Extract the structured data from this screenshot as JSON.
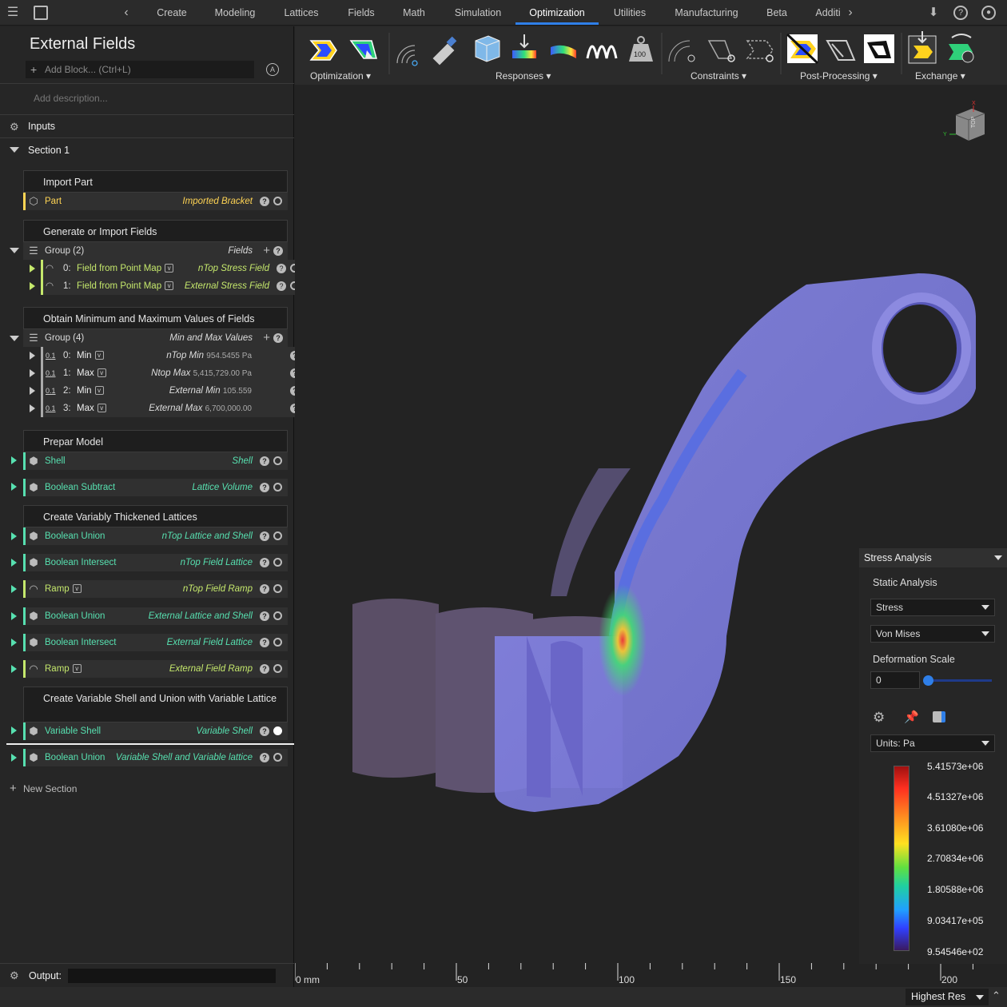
{
  "top_tabs": [
    "Create",
    "Modeling",
    "Lattices",
    "Fields",
    "Math",
    "Simulation",
    "Optimization",
    "Utilities",
    "Manufacturing",
    "Beta",
    "Additi"
  ],
  "active_tab": "Optimization",
  "notebook": {
    "title": "External Fields",
    "add_block_placeholder": "Add Block... (Ctrl+L)",
    "description_placeholder": "Add description...",
    "inputs_label": "Inputs",
    "section_label": "Section 1",
    "new_section_label": "New Section",
    "output_label": "Output:"
  },
  "blocks": {
    "import_part": {
      "title": "Import Part",
      "row": {
        "name": "Part",
        "value": "Imported Bracket"
      }
    },
    "gen_fields": {
      "title": "Generate or Import Fields",
      "group": {
        "name": "Group (2)",
        "value": "Fields"
      },
      "items": [
        {
          "idx": "0:",
          "name": "Field from Point Map",
          "value": "nTop Stress Field"
        },
        {
          "idx": "1:",
          "name": "Field from Point Map",
          "value": "External Stress Field"
        }
      ]
    },
    "minmax": {
      "title": "Obtain Minimum and Maximum Values of Fields",
      "group": {
        "name": "Group (4)",
        "value": "Min and Max Values"
      },
      "items": [
        {
          "idx": "0:",
          "name": "Min",
          "label": "nTop Min",
          "value": "954.5455 Pa"
        },
        {
          "idx": "1:",
          "name": "Max",
          "label": "Ntop Max",
          "value": "5,415,729.00 Pa"
        },
        {
          "idx": "2:",
          "name": "Min",
          "label": "External Min",
          "value": "105.559"
        },
        {
          "idx": "3:",
          "name": "Max",
          "label": "External Max",
          "value": "6,700,000.00"
        }
      ]
    },
    "prep": {
      "title": "Prepar Model",
      "rows": [
        {
          "name": "Shell",
          "value": "Shell"
        },
        {
          "name": "Boolean Subtract",
          "value": "Lattice Volume"
        }
      ]
    },
    "lattices": {
      "title": "Create Variably Thickened Lattices",
      "rows": [
        {
          "name": "Boolean Union",
          "value": "nTop Lattice and Shell"
        },
        {
          "name": "Boolean Intersect",
          "value": "nTop Field Lattice"
        },
        {
          "name": "Ramp",
          "value": "nTop Field Ramp"
        },
        {
          "name": "Boolean Union",
          "value": "External Lattice and Shell"
        },
        {
          "name": "Boolean Intersect",
          "value": "External Field Lattice"
        },
        {
          "name": "Ramp",
          "value": "External Field Ramp"
        }
      ]
    },
    "varshell": {
      "title": "Create Variable Shell and Union with Variable Lattice",
      "rows": [
        {
          "name": "Variable Shell",
          "value": "Variable Shell"
        },
        {
          "name": "Boolean Union",
          "value": "Variable Shell and Variable lattice"
        }
      ]
    }
  },
  "toolbar_groups": [
    "Optimization",
    "Responses",
    "Constraints",
    "Post-Processing",
    "Exchange"
  ],
  "panel": {
    "title": "Stress Analysis",
    "analysis": "Static Analysis",
    "result": "Stress",
    "component": "Von Mises",
    "deformation_label": "Deformation Scale",
    "deformation_value": "0",
    "units": "Units: Pa",
    "legend": [
      "5.41573e+06",
      "4.51327e+06",
      "3.61080e+06",
      "2.70834e+06",
      "1.80588e+06",
      "9.03417e+05",
      "9.54546e+02"
    ]
  },
  "ruler": [
    "0 mm",
    "50",
    "100",
    "150",
    "200"
  ],
  "render_quality": "Highest Res",
  "view_cube_label": "TOP",
  "colors": {
    "accent": "#2f7fe8",
    "block_name": "#57e0b0",
    "part_name": "#ffd454"
  }
}
